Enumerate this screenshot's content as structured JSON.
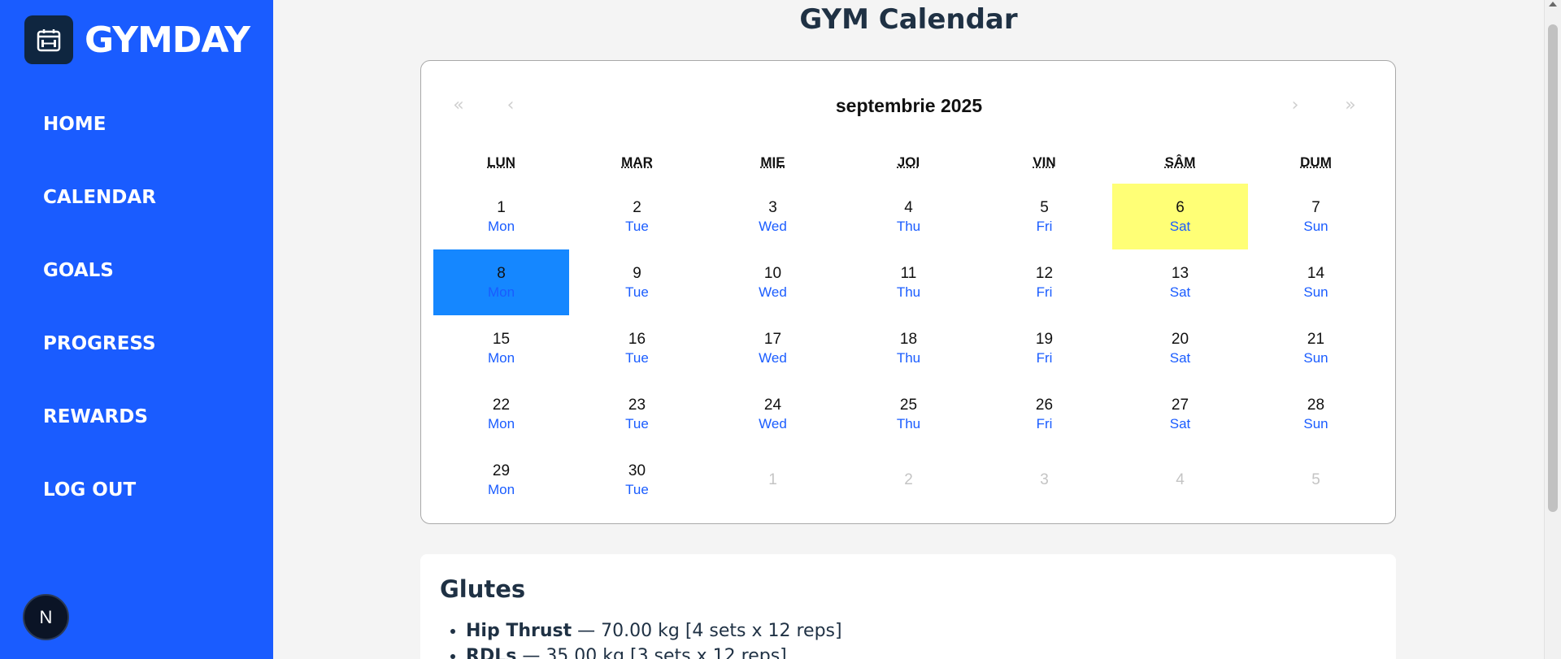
{
  "brand": {
    "name": "GYMDAY",
    "logo_icon": "calendar-dumbbell-icon"
  },
  "nav": [
    "HOME",
    "CALENDAR",
    "GOALS",
    "PROGRESS",
    "REWARDS",
    "LOG OUT"
  ],
  "dev_badge": "N",
  "page_title": "GYM Calendar",
  "calendar": {
    "nav": {
      "prev_year": "«",
      "prev_month": "‹",
      "month_label": "septembrie 2025",
      "next_month": "›",
      "next_year": "»"
    },
    "weekday_headers": [
      "LUN",
      "MAR",
      "MIE",
      "JOI",
      "VIN",
      "SÂM",
      "DUM"
    ],
    "days": [
      {
        "num": "1",
        "wd": "Mon"
      },
      {
        "num": "2",
        "wd": "Tue"
      },
      {
        "num": "3",
        "wd": "Wed"
      },
      {
        "num": "4",
        "wd": "Thu"
      },
      {
        "num": "5",
        "wd": "Fri"
      },
      {
        "num": "6",
        "wd": "Sat",
        "state": "today"
      },
      {
        "num": "7",
        "wd": "Sun"
      },
      {
        "num": "8",
        "wd": "Mon",
        "state": "selected"
      },
      {
        "num": "9",
        "wd": "Tue"
      },
      {
        "num": "10",
        "wd": "Wed"
      },
      {
        "num": "11",
        "wd": "Thu"
      },
      {
        "num": "12",
        "wd": "Fri"
      },
      {
        "num": "13",
        "wd": "Sat"
      },
      {
        "num": "14",
        "wd": "Sun"
      },
      {
        "num": "15",
        "wd": "Mon"
      },
      {
        "num": "16",
        "wd": "Tue"
      },
      {
        "num": "17",
        "wd": "Wed"
      },
      {
        "num": "18",
        "wd": "Thu"
      },
      {
        "num": "19",
        "wd": "Fri"
      },
      {
        "num": "20",
        "wd": "Sat"
      },
      {
        "num": "21",
        "wd": "Sun"
      },
      {
        "num": "22",
        "wd": "Mon"
      },
      {
        "num": "23",
        "wd": "Tue"
      },
      {
        "num": "24",
        "wd": "Wed"
      },
      {
        "num": "25",
        "wd": "Thu"
      },
      {
        "num": "26",
        "wd": "Fri"
      },
      {
        "num": "27",
        "wd": "Sat"
      },
      {
        "num": "28",
        "wd": "Sun"
      },
      {
        "num": "29",
        "wd": "Mon"
      },
      {
        "num": "30",
        "wd": "Tue"
      },
      {
        "num": "1",
        "wd": "",
        "state": "neighbor"
      },
      {
        "num": "2",
        "wd": "",
        "state": "neighbor"
      },
      {
        "num": "3",
        "wd": "",
        "state": "neighbor"
      },
      {
        "num": "4",
        "wd": "",
        "state": "neighbor"
      },
      {
        "num": "5",
        "wd": "",
        "state": "neighbor"
      }
    ],
    "colors": {
      "today": "#ffff76",
      "selected": "#1587ff",
      "weekday_text": "#1a5cff"
    }
  },
  "workout": {
    "title": "Glutes",
    "exercises": [
      {
        "name": "Hip Thrust",
        "detail": " — 70.00 kg [4 sets x 12 reps]"
      },
      {
        "name": "RDLs",
        "detail": " — 35.00 kg [3 sets x 12 reps]"
      }
    ]
  },
  "colors": {
    "sidebar": "#1a5cff",
    "title": "#1f3144"
  }
}
